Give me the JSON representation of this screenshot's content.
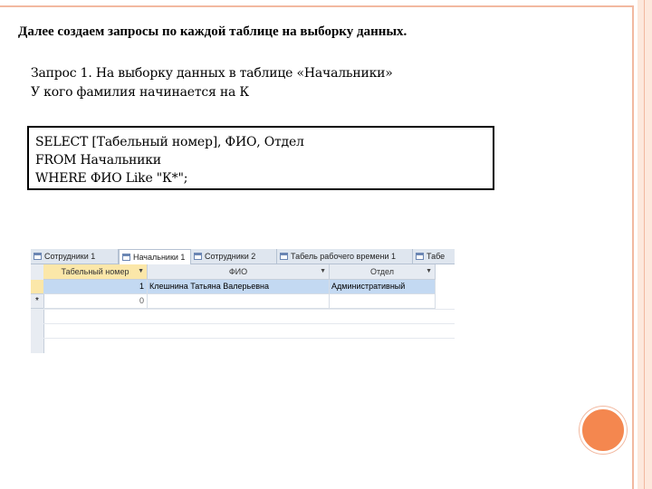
{
  "slide": {
    "title": "Далее создаем запросы по каждой таблице на выборку данных.",
    "line1": "Запрос 1. На выборку данных в таблице «Начальники»",
    "line2": "У кого фамилия начинается на К",
    "sql": [
      "SELECT [Табельный номер], ФИО, Отдел",
      "FROM Начальники",
      "WHERE ФИО Like \"К*\";"
    ]
  },
  "access": {
    "tabs": [
      "Сотрудники 1",
      "Начальники 1",
      "Сотрудники 2",
      "Табель рабочего времени 1",
      "Табе"
    ],
    "columns": [
      "Табельный номер",
      "ФИО",
      "Отдел"
    ],
    "rows": [
      {
        "num": "1",
        "fio": "Клешнина Татьяна Валерьевна",
        "dept": "Административный"
      }
    ],
    "new_row": {
      "marker": "*",
      "num": "0"
    }
  },
  "colors": {
    "accent": "#f4874f",
    "frame": "#f2b9a0",
    "selected_row": "#c3d9f2",
    "active_header": "#fbe7a9"
  }
}
